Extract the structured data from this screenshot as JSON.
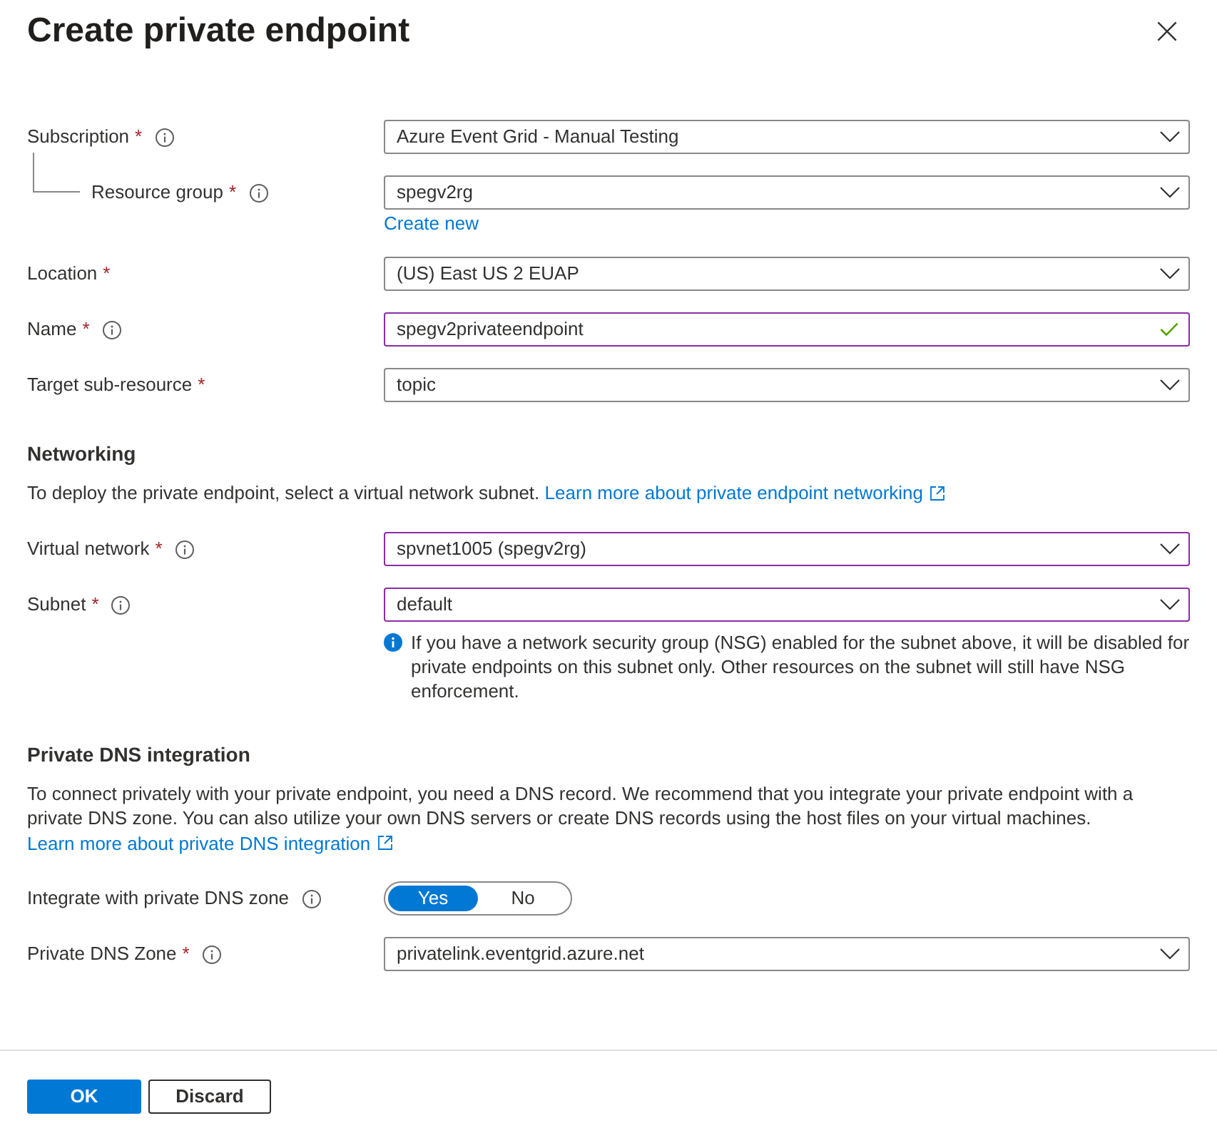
{
  "dialog": {
    "title": "Create private endpoint"
  },
  "sections": [
    {
      "fields": [
        {
          "kind": "dropdown",
          "label": "Subscription",
          "required_mark": "*",
          "info": true,
          "value": "Azure Event Grid - Manual Testing",
          "modified": false,
          "children": [
            {
              "kind": "dropdown",
              "label": "Resource group",
              "required_mark": "*",
              "info": true,
              "value": "spegv2rg",
              "modified": false,
              "link": "Create new"
            }
          ]
        },
        {
          "kind": "dropdown",
          "label": "Location",
          "required_mark": "*",
          "info": false,
          "value": "(US) East US 2 EUAP",
          "modified": false
        },
        {
          "kind": "text",
          "label": "Name",
          "required_mark": "*",
          "info": true,
          "value": "spegv2privateendpoint",
          "modified": true,
          "valid": true
        },
        {
          "kind": "dropdown",
          "label": "Target sub-resource",
          "required_mark": "*",
          "info": false,
          "value": "topic",
          "modified": false
        }
      ]
    },
    {
      "heading": "Networking",
      "description": "To deploy the private endpoint, select a virtual network subnet.",
      "link": "Learn more about private endpoint networking",
      "fields": [
        {
          "kind": "dropdown",
          "label": "Virtual network",
          "required_mark": "*",
          "info": true,
          "value": "spvnet1005 (spegv2rg)",
          "modified": true
        },
        {
          "kind": "dropdown",
          "label": "Subnet",
          "required_mark": "*",
          "info": true,
          "value": "default",
          "modified": true,
          "note": "If you have a network security group (NSG) enabled for the subnet above, it will be disabled for private endpoints on this subnet only. Other resources on the subnet will still have NSG enforcement."
        }
      ]
    },
    {
      "heading": "Private DNS integration",
      "description": "To connect privately with your private endpoint, you need a DNS record. We recommend that you integrate your private endpoint with a private DNS zone. You can also utilize your own DNS servers or create DNS records using the host files on your virtual machines.",
      "link": "Learn more about private DNS integration",
      "fields": [
        {
          "kind": "toggle",
          "label": "Integrate with private DNS zone",
          "info": true,
          "options": [
            {
              "label": "Yes",
              "selected": true
            },
            {
              "label": "No",
              "selected": false
            }
          ]
        },
        {
          "kind": "dropdown",
          "label": "Private DNS Zone",
          "required_mark": "*",
          "info": true,
          "value": "privatelink.eventgrid.azure.net",
          "modified": false
        }
      ]
    }
  ],
  "buttons": [
    {
      "label": "OK",
      "kind": "primary"
    },
    {
      "label": "Discard",
      "kind": "secondary"
    }
  ]
}
